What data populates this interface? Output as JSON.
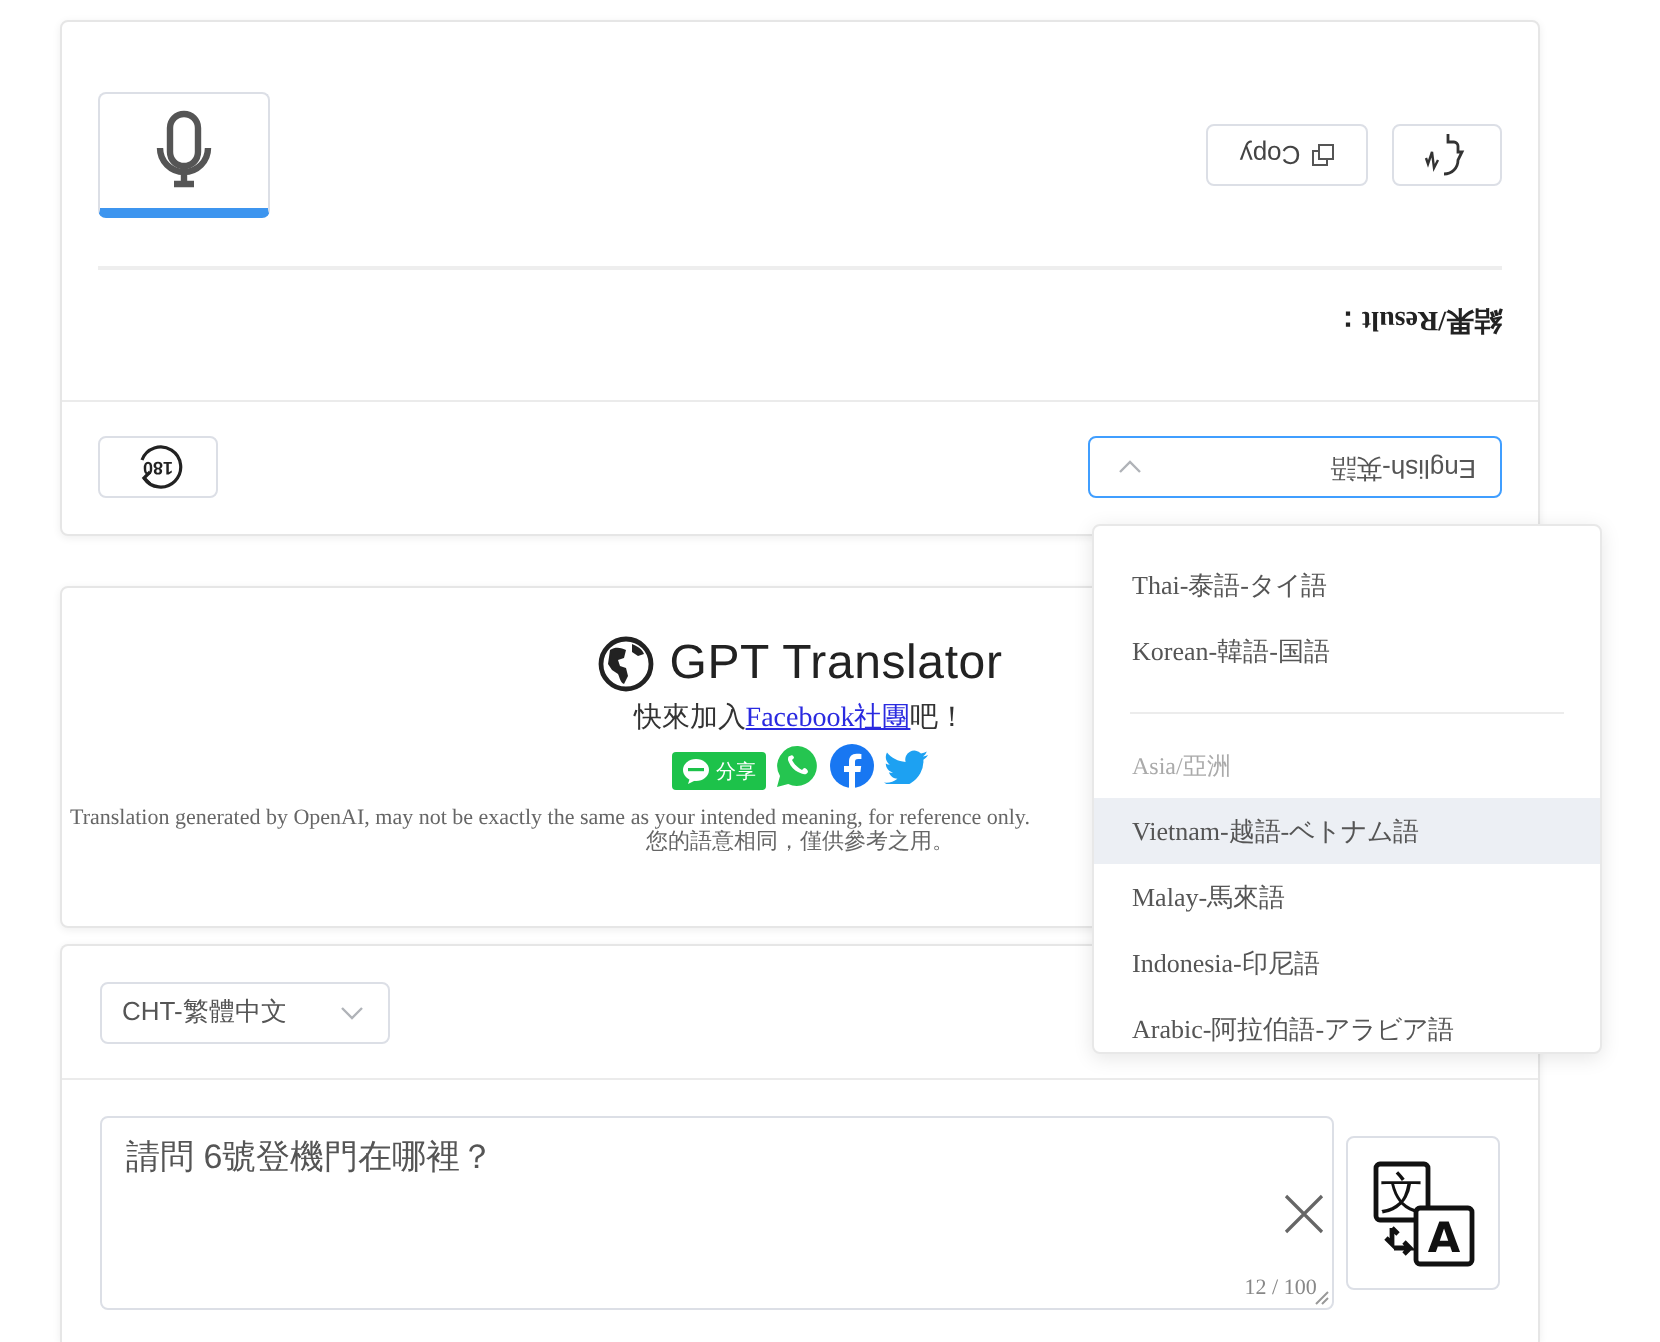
{
  "result_panel": {
    "flipped": true,
    "language_select": {
      "value": "English-英語",
      "open": true
    },
    "rotate_button": {
      "label": "180"
    },
    "result_label": "結果/Result：",
    "copy_button": {
      "label": "Copy"
    },
    "mic_button": {
      "active": true
    }
  },
  "language_menu": {
    "items": [
      {
        "kind": "option",
        "label": "Thai-泰語-タイ語",
        "highlighted": false
      },
      {
        "kind": "option",
        "label": "Korean-韓語-国語",
        "highlighted": false
      },
      {
        "kind": "divider"
      },
      {
        "kind": "group",
        "label": "Asia/亞洲"
      },
      {
        "kind": "option",
        "label": "Vietnam-越語-ベトナム語",
        "highlighted": true
      },
      {
        "kind": "option",
        "label": "Malay-馬來語",
        "highlighted": false
      },
      {
        "kind": "option",
        "label": "Indonesia-印尼語",
        "highlighted": false
      },
      {
        "kind": "option",
        "label": "Arabic-阿拉伯語-アラビア語",
        "highlighted": false
      }
    ]
  },
  "footer": {
    "title": "GPT Translator",
    "join": {
      "before": "快來加入",
      "link": "Facebook社團",
      "after": "吧！"
    },
    "share_label": "分享",
    "disclaimer": [
      "Translation generated by OpenAI, may not be exactly the same as your intended meaning, for reference only.",
      "您的語意相同，僅供參考之用。"
    ]
  },
  "input_panel": {
    "language_select": {
      "value": "CHT-繁體中文"
    },
    "text": "請問 6號登機門在哪裡？",
    "counter": "12 / 100",
    "translate_button": {
      "glyphs": [
        "文",
        "A"
      ]
    }
  }
}
